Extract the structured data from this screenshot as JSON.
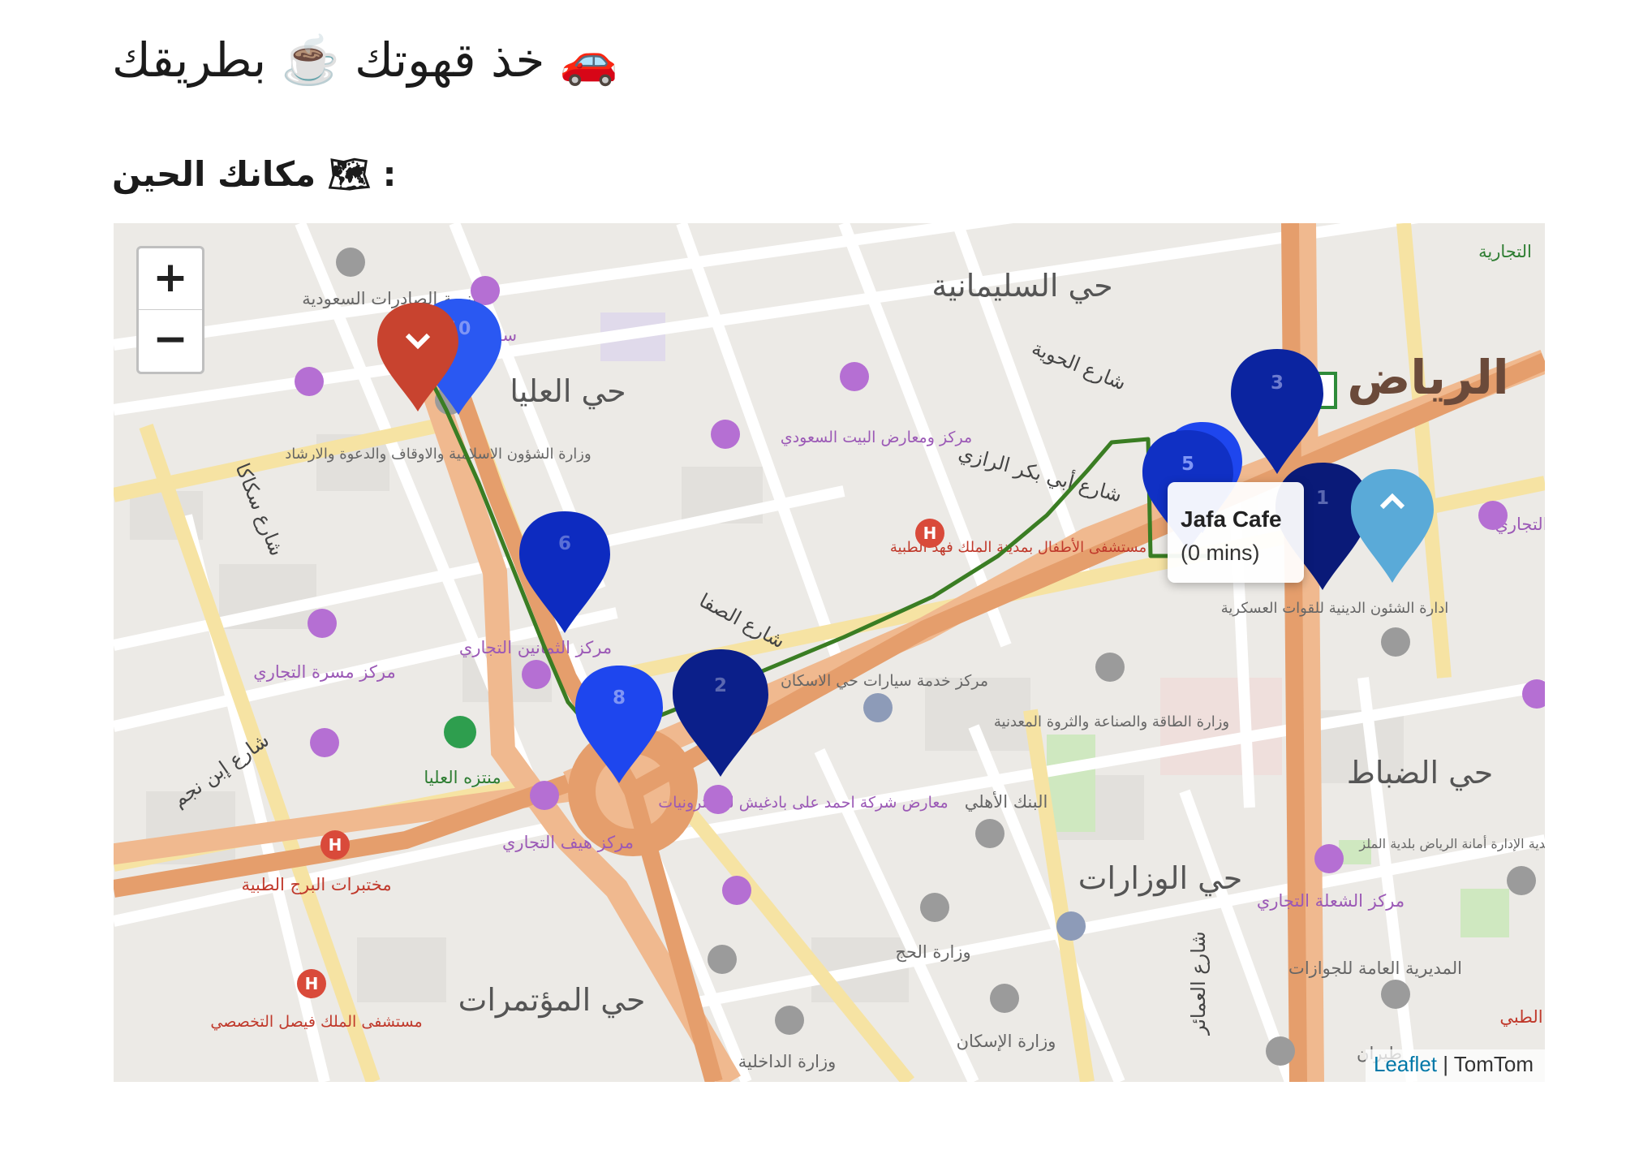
{
  "page": {
    "title": "خذ قهوتك ☕️ بطريقك 🚗",
    "subtitle": "مكانك الحين 🗺 :"
  },
  "map": {
    "zoom_in": "+",
    "zoom_out": "−",
    "popup": {
      "name": "Jafa Cafe",
      "duration": "(0 mins)"
    },
    "attribution": {
      "link": "Leaflet",
      "separator": " | ",
      "provider": "TomTom"
    },
    "route_color": "#3a7d23",
    "start_marker_color": "#c8432f",
    "current_marker_color": "#5aaad8",
    "cafe_markers": [
      {
        "label": "1",
        "color": "#0a1a78"
      },
      {
        "label": "2",
        "color": "#0b1f8a"
      },
      {
        "label": "3",
        "color": "#0b24a0"
      },
      {
        "label": "5",
        "color": "#1030c4"
      },
      {
        "label": "6",
        "color": "#0d2bc0"
      },
      {
        "label": "8",
        "color": "#1e46ee"
      },
      {
        "label": "10",
        "color": "#2a58f2"
      }
    ],
    "place_labels": {
      "sulaimaniyah": "حي السليمانية",
      "olaya": "حي العليا",
      "riyadh": "الرياض",
      "dhubbat": "حي الضباط",
      "wizarat": "حي الوزارات",
      "mutamarat": "حي المؤتمرات",
      "safa_st": "شارع الصفا",
      "hawiyah_st": "شارع الحوية",
      "abubakr_st": "شارع أبي بكر الرازي",
      "sikaka_st": "شارع سكاكا",
      "ibnnajm_st": "شارع إبن نجم",
      "ammar_st": "شارع العمائر",
      "export_dev": "تنمية الصادرات السعودية",
      "santria": "سنتريا",
      "islamic_affairs": "وزارة الشؤون الاسلامية والاوقاف والدعوة والارشاد",
      "bayt_saudi": "مركز ومعارض البيت السعودي",
      "children_hosp": "مستشفى الأطفال بمدينة الملك فهد الطبية",
      "thumaniyin": "مركز الثمانين التجاري",
      "car_service": "مركز خدمة سيارات حي الاسكان",
      "masarrah": "مركز مسرة التجاري",
      "olaya_park": "منتزه العليا",
      "haif": "مركز هيف التجاري",
      "ahmad_ali": "معارض شركة احمد على بادغيش للالكترونيات",
      "ahli_bank": "البنك الأهلي",
      "energy_ministry": "وزارة الطاقة والصناعة والثروة المعدنية",
      "burj_labs": "مختبرات البرج الطبية",
      "faisal_hosp": "مستشفى الملك فيصل التخصصي",
      "interior": "وزارة الداخلية",
      "hajj": "وزارة الحج",
      "housing": "وزارة الإسكان",
      "religious_affairs": "ادارة الشئون الدينية للقوات العسكرية",
      "shuala": "مركز الشعلة التجاري",
      "passports": "المديرية العامة للجوازات",
      "malaz_municipality": "البلدية الإدارة أمانة الرياض بلدية الملز",
      "aviation": "طيران",
      "commercial_top": "التجارية",
      "tajari_right": "التجاري",
      "tibbi": "الطبي"
    }
  }
}
